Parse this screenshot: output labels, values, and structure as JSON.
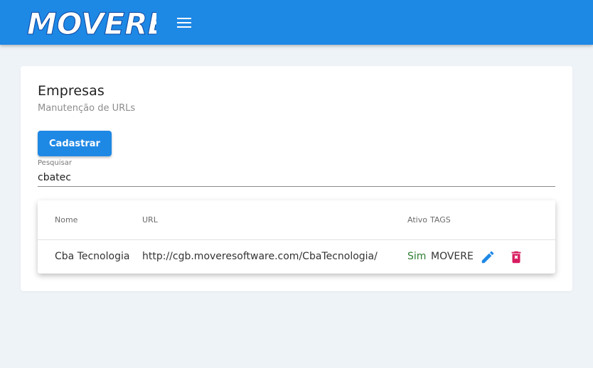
{
  "app": {
    "logo_text": "MOVERE"
  },
  "page": {
    "title": "Empresas",
    "subtitle": "Manutenção de URLs",
    "register_button": "Cadastrar"
  },
  "search": {
    "label": "Pesquisar",
    "value": "cbatec"
  },
  "table": {
    "headers": {
      "name": "Nome",
      "url": "URL",
      "active": "Ativo",
      "tags": "TAGS"
    },
    "rows": [
      {
        "name": "Cba Tecnologia",
        "url": "http://cgb.moveresoftware.com/CbaTecnologia/",
        "active": "Sim",
        "tags": "MOVERE"
      }
    ]
  },
  "colors": {
    "primary": "#1e88e5",
    "active_green": "#2e7d32",
    "delete_red": "#d81b60"
  },
  "icons": {
    "menu": "menu-icon",
    "edit": "pencil-icon",
    "delete": "trash-icon"
  }
}
